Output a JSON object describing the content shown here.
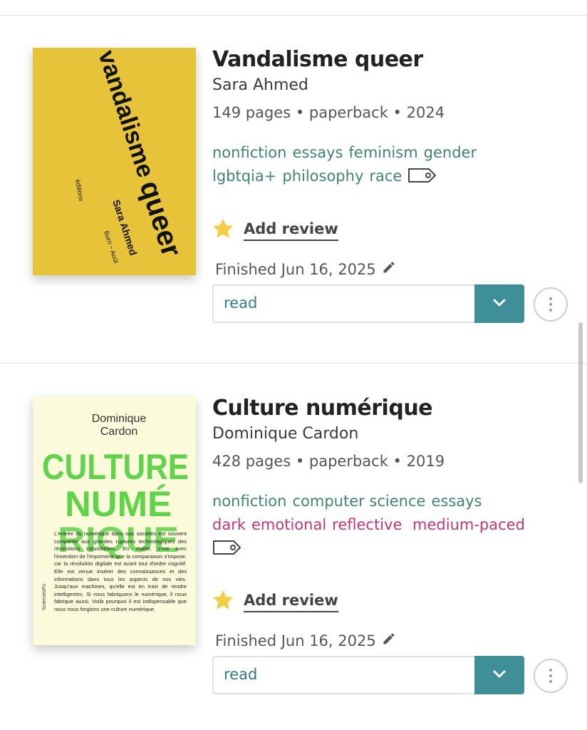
{
  "books": [
    {
      "title": "Vandalisme queer",
      "author": "Sara Ahmed",
      "meta": "149 pages • paperback • 2024",
      "genre_tags": [
        "nonfiction",
        "essays",
        "feminism",
        "gender",
        "lgbtqia+",
        "philosophy",
        "race"
      ],
      "mood_tags": [],
      "review_label": "Add review",
      "finished": "Finished Jun 16, 2025",
      "status": "read",
      "cover": {
        "title_line1": "vandalisme",
        "title_line2": "queer",
        "author": "Sara Ahmed",
        "publisher": "éditions",
        "collection": "Burn ~ Août",
        "bg": "#e6c338"
      }
    },
    {
      "title": "Culture numérique",
      "author": "Dominique Cardon",
      "meta": "428 pages • paperback • 2019",
      "genre_tags": [
        "nonfiction",
        "computer science",
        "essays"
      ],
      "mood_tags": [
        "dark",
        "emotional",
        "reflective",
        "medium-paced"
      ],
      "review_label": "Add review",
      "finished": "Finished Jun 16, 2025",
      "status": "read",
      "cover": {
        "author_line1": "Dominique",
        "author_line2": "Cardon",
        "title_line1": "CULTURE",
        "title_line2": "NUMÉ",
        "title_line3": "RIQUE",
        "blurb": "L'entrée du numérique dans nos sociétés est souvent comparée aux grandes ruptures technologiques des révolutions industrielles. En réalité, c'est avec l'invention de l'imprimerie que la comparaison s'impose, car la révolution digitale est avant tout d'ordre cognitif. Elle est venue insérer des connaissances et des informations dans tous les aspects de nos vies. Jusqu'aux machines, qu'elle est en train de rendre intelligentes. Si nous fabriquons le numérique, il nous fabrique aussi. Voilà pourquoi il est indispensable que nous nous forgions une culture numérique.",
        "publisher": "SciencesPo",
        "bg": "#fbfbdc",
        "title_color": "#5fd34a"
      }
    }
  ],
  "colors": {
    "genre_tag": "#3f8572",
    "mood_tag": "#c2367a",
    "status_button": "#3f8f98",
    "star": "#f2cf45"
  },
  "icons": {
    "star": "star-icon",
    "pencil": "pencil-icon",
    "tag": "tag-icon",
    "chevron": "chevron-down-icon",
    "more": "more-options-icon"
  }
}
